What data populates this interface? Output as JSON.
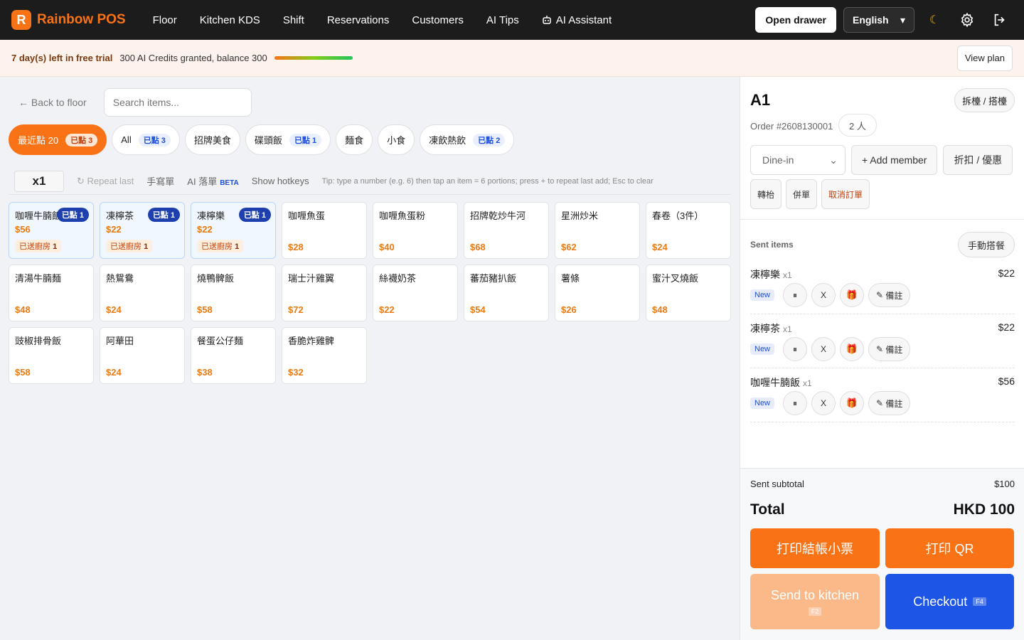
{
  "app": {
    "logo_letter": "R",
    "name": "Rainbow POS"
  },
  "nav": [
    "Floor",
    "Kitchen KDS",
    "Shift",
    "Reservations",
    "Customers",
    "AI Tips",
    "AI Assistant"
  ],
  "topbar": {
    "open_drawer": "Open drawer",
    "language": "English",
    "language_caret": "▾",
    "theme_icon": "moon-icon",
    "settings_icon": "gear-icon",
    "logout_icon": "logout-icon"
  },
  "trial": {
    "days_left": "7 day(s) left in free trial",
    "credits": "300 AI Credits granted, balance 300",
    "credit_fraction": 1.0,
    "view_plan": "View plan"
  },
  "toolbar": {
    "back": "← Back to floor",
    "search_placeholder": "Search items..."
  },
  "categories": [
    {
      "label": "最近點 20",
      "badge": "已點 3",
      "active": true
    },
    {
      "label": "All",
      "badge": "已點 3"
    },
    {
      "label": "招牌美食",
      "badge": ""
    },
    {
      "label": "碟頭飯",
      "badge": "已點 1"
    },
    {
      "label": "麵食",
      "badge": ""
    },
    {
      "label": "小食",
      "badge": ""
    },
    {
      "label": "凍飲熱飲",
      "badge": "已點 2"
    }
  ],
  "tools": {
    "qty": "x1",
    "repeat": "↻ Repeat last",
    "handwrite": "手寫單",
    "ai_order": "AI 落單",
    "beta": "BETA",
    "hotkeys": "Show hotkeys",
    "tip": "Tip: type a number (e.g. 6) then tap an item = 6 portions; press + to repeat last add; Esc to clear"
  },
  "items": [
    {
      "name": "咖喱牛腩飯",
      "price": "$56",
      "ordered": "已點 1",
      "sent_label": "已送廚房",
      "sent_count": "1"
    },
    {
      "name": "凍檸茶",
      "price": "$22",
      "ordered": "已點 1",
      "sent_label": "已送廚房",
      "sent_count": "1"
    },
    {
      "name": "凍檸樂",
      "price": "$22",
      "ordered": "已點 1",
      "sent_label": "已送廚房",
      "sent_count": "1"
    },
    {
      "name": "咖喱魚蛋",
      "price": "$28"
    },
    {
      "name": "咖喱魚蛋粉",
      "price": "$40"
    },
    {
      "name": "招牌乾炒牛河",
      "price": "$68"
    },
    {
      "name": "星洲炒米",
      "price": "$62"
    },
    {
      "name": "春卷（3件）",
      "price": "$24"
    },
    {
      "name": "清湯牛腩麵",
      "price": "$48"
    },
    {
      "name": "熱鴛鴦",
      "price": "$24"
    },
    {
      "name": "燒鴨髀飯",
      "price": "$58"
    },
    {
      "name": "瑞士汁雞翼",
      "price": "$72"
    },
    {
      "name": "絲襪奶茶",
      "price": "$22"
    },
    {
      "name": "蕃茄豬扒飯",
      "price": "$54"
    },
    {
      "name": "薯條",
      "price": "$26"
    },
    {
      "name": "蜜汁叉燒飯",
      "price": "$48"
    },
    {
      "name": "豉椒排骨飯",
      "price": "$58"
    },
    {
      "name": "阿華田",
      "price": "$24"
    },
    {
      "name": "餐蛋公仔麵",
      "price": "$38"
    },
    {
      "name": "香脆炸雞髀",
      "price": "$32"
    }
  ],
  "order": {
    "table": "A1",
    "split": "拆檯 / 搭檯",
    "order_no": "Order #2608130001",
    "people": "2 人",
    "mode": "Dine-in",
    "add_member": "+ Add member",
    "discount": "折扣 / 優惠",
    "transfer": "轉枱",
    "merge": "併單",
    "cancel": "取消訂單",
    "sent_title": "Sent items",
    "manual_combo": "手動搭餐",
    "lines": [
      {
        "name": "凍檸樂",
        "qty": "x1",
        "price": "$22",
        "status": "New",
        "pause": "⏸",
        "void": "X",
        "note": "備註"
      },
      {
        "name": "凍檸茶",
        "qty": "x1",
        "price": "$22",
        "status": "New",
        "pause": "⏸",
        "void": "X",
        "note": "備註"
      },
      {
        "name": "咖喱牛腩飯",
        "qty": "x1",
        "price": "$56",
        "status": "New",
        "pause": "⏸",
        "void": "X",
        "note": "備註"
      }
    ],
    "sent_subtotal_label": "Sent subtotal",
    "sent_subtotal": "$100",
    "total_label": "Total",
    "total": "HKD 100",
    "print_bill": "打印結帳小票",
    "print_qr": "打印 QR",
    "send_kitchen": "Send to kitchen",
    "send_key": "F2",
    "checkout": "Checkout",
    "checkout_key": "F4"
  },
  "colors": {
    "accent": "#f97316",
    "primary_blue": "#1d55e6",
    "topbar": "#1c1c1c"
  }
}
